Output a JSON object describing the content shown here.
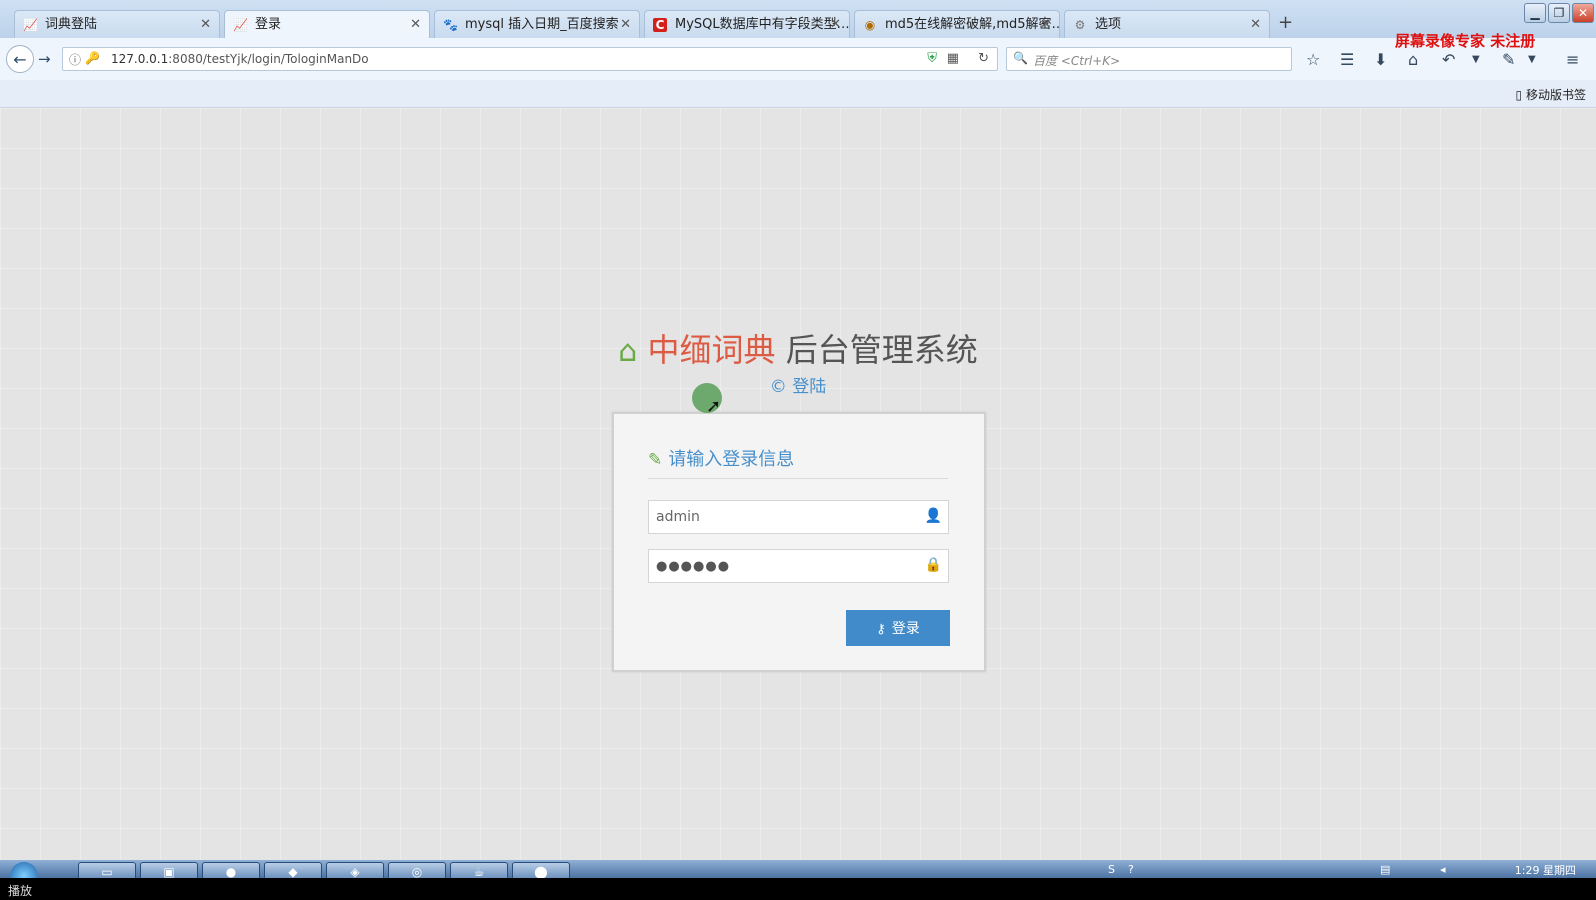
{
  "browser": {
    "tabs": [
      {
        "label": "词典登陆",
        "icon": "chart-icon",
        "active": false
      },
      {
        "label": "登录",
        "icon": "chart-icon",
        "active": true
      },
      {
        "label": "mysql 插入日期_百度搜索",
        "icon": "baidu-paw-icon",
        "active": false
      },
      {
        "label": "MySQL数据库中有字段类型…",
        "icon": "c-logo-icon",
        "active": false
      },
      {
        "label": "md5在线解密破解,md5解密…",
        "icon": "md5-logo-icon",
        "active": false
      },
      {
        "label": "选项",
        "icon": "gear-icon",
        "active": false
      }
    ],
    "url_host": "127.0.0.1",
    "url_rest": ":8080/testYjk/login/TologinManDo",
    "search_placeholder": "百度 <Ctrl+K>",
    "mobile_bookmarks": "移动版书签",
    "watermark": "屏幕录像专家  未注册"
  },
  "page": {
    "brand_red": "中缅词典",
    "brand_gray": "后台管理系统",
    "subtitle": "© 登陆",
    "login": {
      "heading": "请输入登录信息",
      "username_value": "admin",
      "password_value": "●●●●●●",
      "submit_label": "登录"
    }
  },
  "taskbar": {
    "clock": "1:29 星期四"
  },
  "player": {
    "label": "播放"
  },
  "colors": {
    "brand_red": "#dd5a43",
    "accent_blue": "#428bca",
    "icon_green": "#69aa46"
  }
}
